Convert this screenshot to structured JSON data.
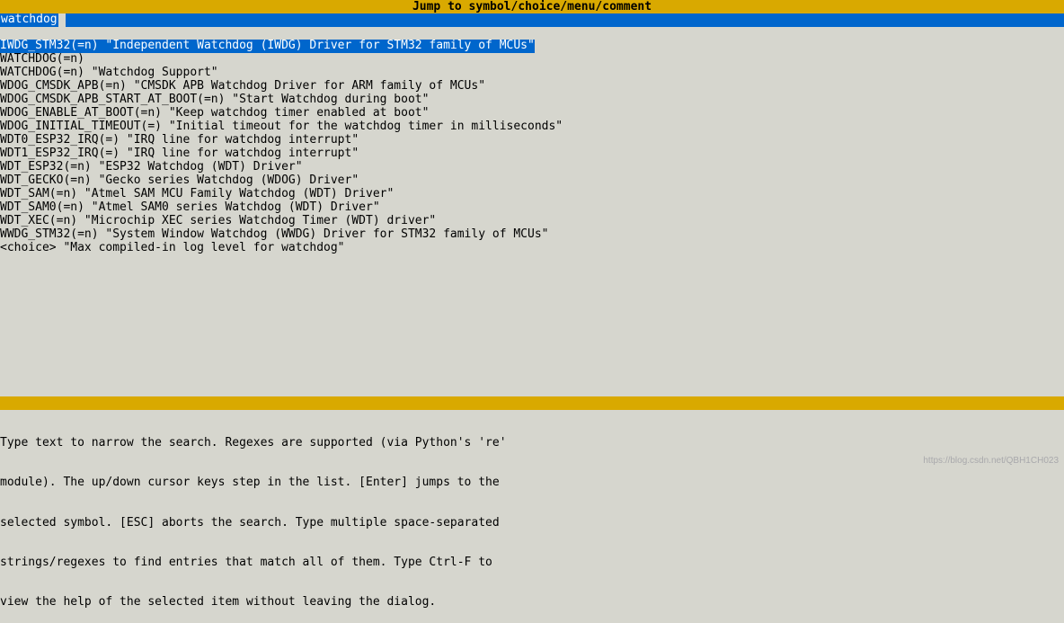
{
  "title": "Jump to symbol/choice/menu/comment",
  "search": {
    "query": "watchdog"
  },
  "results": [
    {
      "text": "IWDG_STM32(=n) \"Independent Watchdog (IWDG) Driver for STM32 family of MCUs\"",
      "selected": true
    },
    {
      "text": "WATCHDOG(=n)",
      "selected": false
    },
    {
      "text": "WATCHDOG(=n) \"Watchdog Support\"",
      "selected": false
    },
    {
      "text": "WDOG_CMSDK_APB(=n) \"CMSDK APB Watchdog Driver for ARM family of MCUs\"",
      "selected": false
    },
    {
      "text": "WDOG_CMSDK_APB_START_AT_BOOT(=n) \"Start Watchdog during boot\"",
      "selected": false
    },
    {
      "text": "WDOG_ENABLE_AT_BOOT(=n) \"Keep watchdog timer enabled at boot\"",
      "selected": false
    },
    {
      "text": "WDOG_INITIAL_TIMEOUT(=) \"Initial timeout for the watchdog timer in milliseconds\"",
      "selected": false
    },
    {
      "text": "WDT0_ESP32_IRQ(=) \"IRQ line for watchdog interrupt\"",
      "selected": false
    },
    {
      "text": "WDT1_ESP32_IRQ(=) \"IRQ line for watchdog interrupt\"",
      "selected": false
    },
    {
      "text": "WDT_ESP32(=n) \"ESP32 Watchdog (WDT) Driver\"",
      "selected": false
    },
    {
      "text": "WDT_GECKO(=n) \"Gecko series Watchdog (WDOG) Driver\"",
      "selected": false
    },
    {
      "text": "WDT_SAM(=n) \"Atmel SAM MCU Family Watchdog (WDT) Driver\"",
      "selected": false
    },
    {
      "text": "WDT_SAM0(=n) \"Atmel SAM0 series Watchdog (WDT) Driver\"",
      "selected": false
    },
    {
      "text": "WDT_XEC(=n) \"Microchip XEC series Watchdog Timer (WDT) driver\"",
      "selected": false
    },
    {
      "text": "WWDG_STM32(=n) \"System Window Watchdog (WWDG) Driver for STM32 family of MCUs\"",
      "selected": false
    },
    {
      "text": "<choice> \"Max compiled-in log level for watchdog\"",
      "selected": false
    }
  ],
  "help": {
    "line1": "Type text to narrow the search. Regexes are supported (via Python's 're'",
    "line2": "module). The up/down cursor keys step in the list. [Enter] jumps to the",
    "line3": "selected symbol. [ESC] aborts the search. Type multiple space-separated",
    "line4": "strings/regexes to find entries that match all of them. Type Ctrl-F to",
    "line5": "view the help of the selected item without leaving the dialog."
  },
  "watermark": "https://blog.csdn.net/QBH1CH023"
}
